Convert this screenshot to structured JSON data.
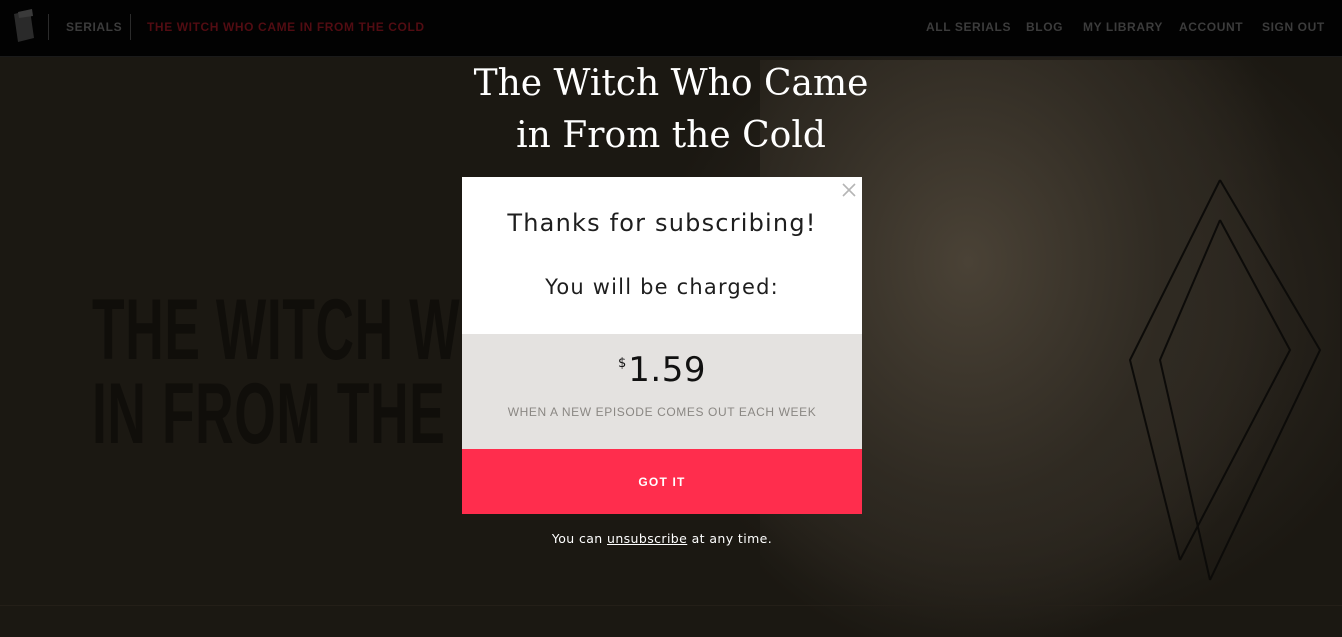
{
  "nav": {
    "section_label": "SERIALS",
    "current_serial": "THE WITCH WHO CAME IN FROM THE COLD",
    "links": [
      "ALL SERIALS",
      "BLOG",
      "MY LIBRARY",
      "ACCOUNT",
      "SIGN OUT"
    ],
    "current_color": "#520c12"
  },
  "hero": {
    "title_line1": "The Witch Who Came",
    "title_line2": "in From the Cold",
    "cover_text_line1": "THE WITCH W",
    "cover_text_line2": "IN FROM THE C"
  },
  "modal": {
    "heading": "Thanks for subscribing!",
    "charge_label": "You will be charged:",
    "currency_symbol": "$",
    "price": "1.59",
    "frequency_note": "WHEN A NEW EPISODE COMES OUT EACH WEEK",
    "confirm_label": "GOT IT",
    "close_icon": "close-icon",
    "accent_color": "#ff2d4d"
  },
  "footer_note": {
    "prefix": "You can ",
    "link_label": "unsubscribe",
    "suffix": " at any time."
  }
}
